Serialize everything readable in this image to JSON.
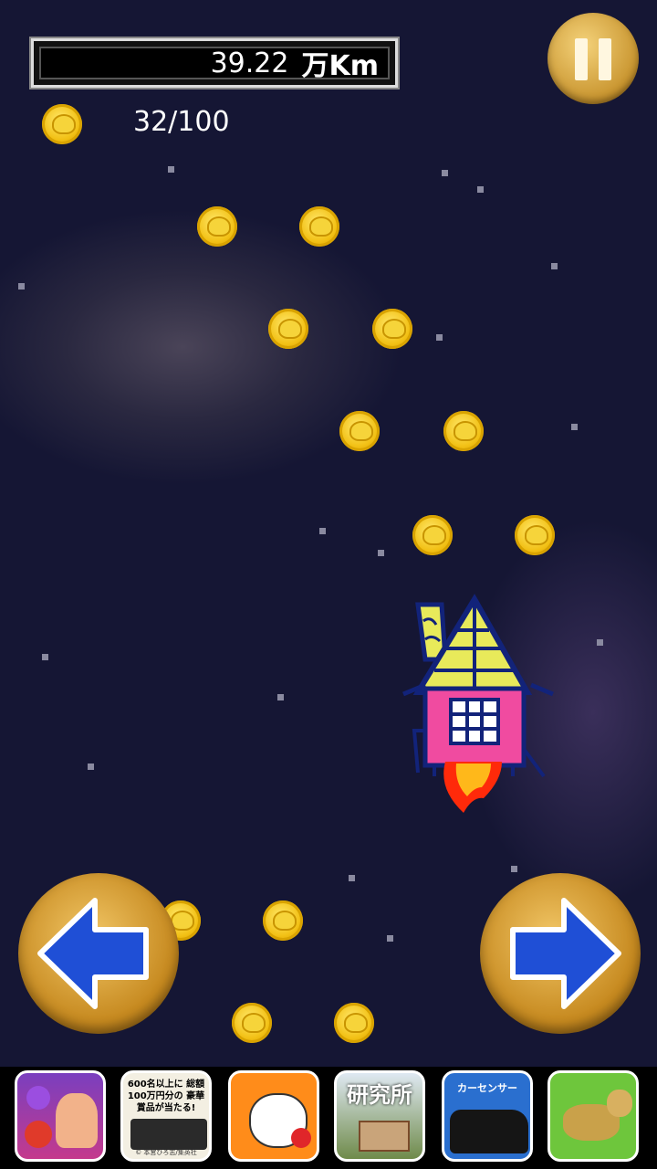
{
  "hud": {
    "distance_value": "39.22",
    "distance_unit": "万Km",
    "coin_count": "32/100"
  },
  "icons": {
    "pause": "pause-icon",
    "left": "left-arrow-icon",
    "right": "right-arrow-icon",
    "coin": "coin-icon",
    "player": "flying-house-rocket"
  },
  "ads": {
    "ad2_text": "600名以上に 総額100万円分の 豪華賞品が当たる!",
    "ad2_footer": "© 本宮ひろ志/集英社",
    "ad4_text": "研究所",
    "ad5_text": "カーセンサー"
  },
  "colors": {
    "background": "#151634",
    "coin": "#f2c014",
    "button_gold": "#c6891f",
    "arrow_blue": "#1f4fd6"
  }
}
